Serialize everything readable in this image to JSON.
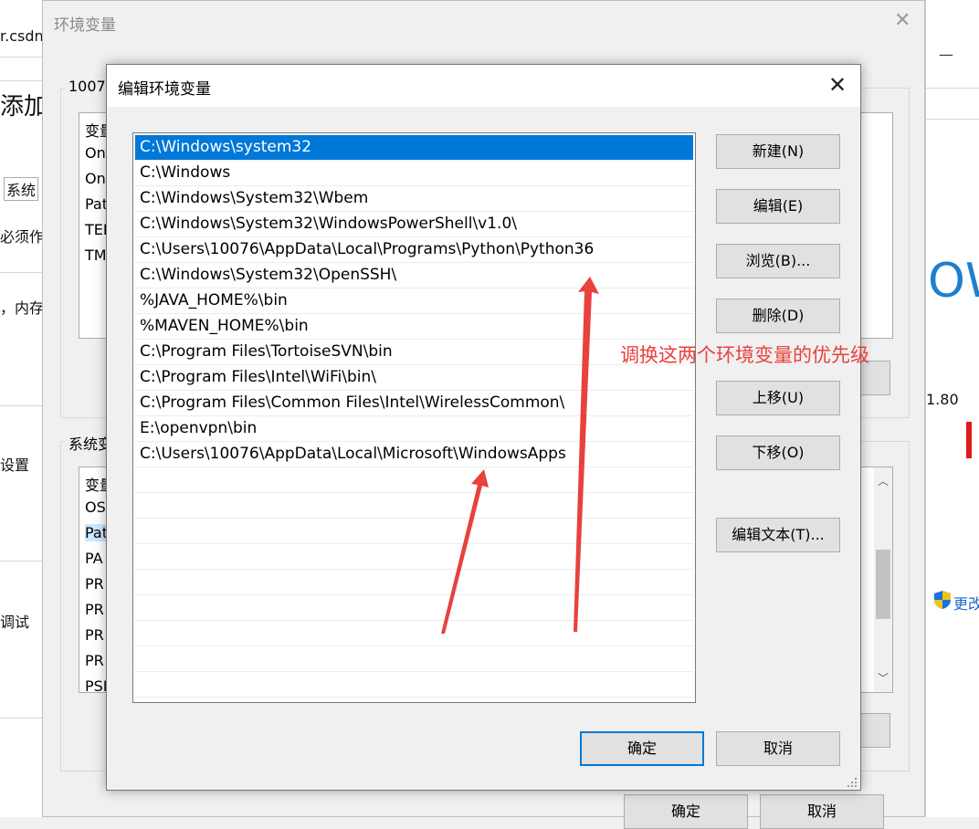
{
  "background": {
    "left_fragments": [
      "r.csdn",
      "添加",
      "系统",
      "必须作",
      "，内存",
      "设置",
      "调试"
    ],
    "right_fragments": [
      "—",
      "OW",
      "1.80",
      "更改"
    ]
  },
  "outer_dialog": {
    "title": "环境变量",
    "user_group_label": "1007",
    "user_list_header": "变量",
    "user_list_items": [
      "On",
      "On",
      "Pat",
      "TEI",
      "TM"
    ],
    "system_group_label": "系统变",
    "system_list_header": "变量",
    "system_list_items": [
      "OS",
      "Pat",
      "PA",
      "PR",
      "PR",
      "PR",
      "PR",
      "PSI"
    ],
    "ok_label": "确定",
    "cancel_label": "取消"
  },
  "dialog": {
    "title": "编辑环境变量",
    "paths": [
      "C:\\Windows\\system32",
      "C:\\Windows",
      "C:\\Windows\\System32\\Wbem",
      "C:\\Windows\\System32\\WindowsPowerShell\\v1.0\\",
      "C:\\Users\\10076\\AppData\\Local\\Programs\\Python\\Python36",
      "C:\\Windows\\System32\\OpenSSH\\",
      "%JAVA_HOME%\\bin",
      "%MAVEN_HOME%\\bin",
      "C:\\Program Files\\TortoiseSVN\\bin",
      "C:\\Program Files\\Intel\\WiFi\\bin\\",
      "C:\\Program Files\\Common Files\\Intel\\WirelessCommon\\",
      "E:\\openvpn\\bin",
      "C:\\Users\\10076\\AppData\\Local\\Microsoft\\WindowsApps"
    ],
    "selected_index": 0,
    "buttons": {
      "new": "新建(N)",
      "edit": "编辑(E)",
      "browse": "浏览(B)...",
      "delete": "删除(D)",
      "move_up": "上移(U)",
      "move_down": "下移(O)",
      "edit_text": "编辑文本(T)..."
    },
    "ok_label": "确定",
    "cancel_label": "取消"
  },
  "annotation": {
    "text": "调换这两个环境变量的优先级",
    "color": "#e8413e"
  },
  "colors": {
    "selection": "#0078d7",
    "dialog_bg": "#f0f0f0"
  }
}
